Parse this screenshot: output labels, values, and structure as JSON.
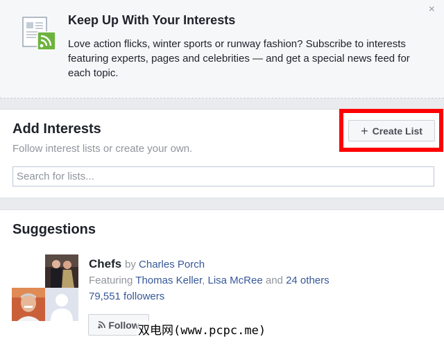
{
  "intro": {
    "title": "Keep Up With Your Interests",
    "text": "Love action flicks, winter sports or runway fashion? Subscribe to interests featuring experts, pages and celebrities — and get a special news feed for each topic.",
    "close_glyph": "×",
    "icon": "news-feed-document-icon"
  },
  "add_interests": {
    "title": "Add Interests",
    "subtitle": "Follow interest lists or create your own.",
    "create_button_label": "Create List",
    "create_button_icon": "plus-icon",
    "search_placeholder": "Search for lists...",
    "search_value": "",
    "highlight_color": "#ff0000"
  },
  "suggestions": {
    "title": "Suggestions",
    "items": [
      {
        "name": "Chefs",
        "by_label": "by",
        "author": "Charles Porch",
        "featuring_label": "Featuring",
        "featured_1": "Thomas Keller",
        "separator": ",",
        "featured_2": "Lisa McRee",
        "and_label": "and",
        "others": "24 others",
        "followers": "79,551 followers",
        "follow_label": "Follow",
        "follow_icon": "rss-icon"
      }
    ]
  },
  "watermark": "双电网(www.pcpc.me)",
  "colors": {
    "link": "#365899",
    "banner_bg": "#f6f7f9",
    "page_bg": "#e9ebee",
    "rss_green": "#6cb33f"
  }
}
